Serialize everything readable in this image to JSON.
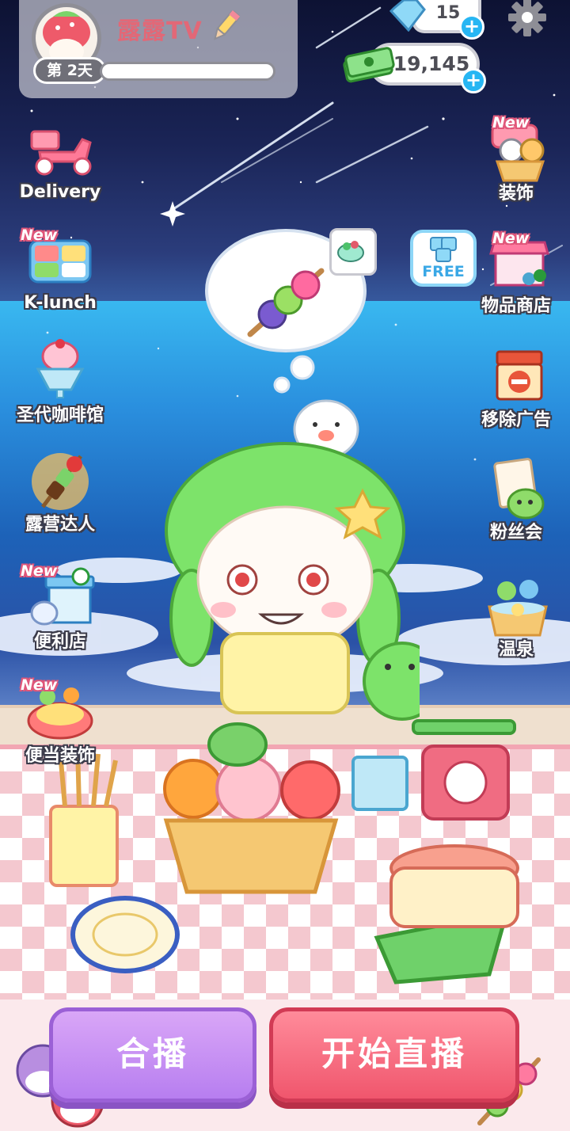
{
  "profile": {
    "username": "露露TV",
    "day_label": "第 2天",
    "progress_fraction": 0.0
  },
  "currency": {
    "gems": "15",
    "cash": "19,145"
  },
  "left_menu": [
    {
      "label": "Delivery",
      "icon": "scooter-icon",
      "new": false,
      "new_label": ""
    },
    {
      "label": "K-lunch",
      "icon": "lunchbox-icon",
      "new": true,
      "new_label": "New"
    },
    {
      "label": "圣代咖啡馆",
      "icon": "sundae-icon",
      "new": false,
      "new_label": ""
    },
    {
      "label": "露营达人",
      "icon": "skewer-icon",
      "new": false,
      "new_label": ""
    },
    {
      "label": "便利店",
      "icon": "store-icon",
      "new": true,
      "new_label": "New"
    },
    {
      "label": "便当装饰",
      "icon": "bento-icon",
      "new": true,
      "new_label": "New"
    }
  ],
  "right_menu": [
    {
      "label": "装饰",
      "icon": "decor-basket-icon",
      "new": true,
      "new_label": "New"
    },
    {
      "label": "物品商店",
      "icon": "shop-stall-icon",
      "new": true,
      "new_label": "New"
    },
    {
      "label": "移除广告",
      "icon": "no-ads-icon",
      "new": false,
      "new_label": ""
    },
    {
      "label": "粉丝会",
      "icon": "fan-letter-icon",
      "new": false,
      "new_label": ""
    },
    {
      "label": "温泉",
      "icon": "hot-spring-icon",
      "new": false,
      "new_label": ""
    }
  ],
  "free_badge": {
    "label": "FREE"
  },
  "buttons": {
    "cobroadcast": "合播",
    "start_live": "开始直播"
  },
  "colors": {
    "accent_pink": "#f0566d",
    "accent_purple": "#b77ef0",
    "username": "#e26877",
    "plus_blue": "#27b6f3"
  }
}
